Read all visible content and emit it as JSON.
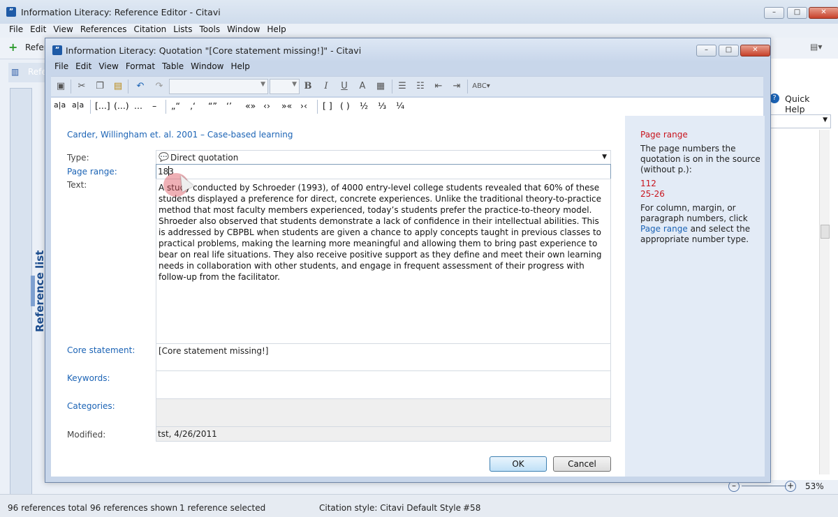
{
  "main": {
    "title": "Information Literacy: Reference Editor - Citavi",
    "menu": [
      "File",
      "Edit",
      "View",
      "References",
      "Citation",
      "Lists",
      "Tools",
      "Window",
      "Help"
    ],
    "toolbar_partial": "Refer",
    "left_tab_partial": "Refe",
    "reference_list_label": "Reference list",
    "quick_help_label": "Quick Help",
    "zoom": "53%"
  },
  "status": {
    "total": "96 references total",
    "shown": "96 references shown",
    "selected": "1 reference selected",
    "style": "Citation style: Citavi Default Style",
    "number": "#58"
  },
  "dialog": {
    "title": "Information Literacy: Quotation \"[Core statement missing!]\" - Citavi",
    "menu": [
      "File",
      "Edit",
      "View",
      "Format",
      "Table",
      "Window",
      "Help"
    ],
    "toolbar2_symbols": [
      "a|a",
      "a|a",
      "[...]",
      "(...)",
      "...",
      "–",
      "„“",
      "‚‘",
      "“”",
      "‘’",
      "«»",
      "‹›",
      "»«",
      "›‹",
      "[ ]",
      "( )",
      "½",
      "⅓",
      "¼"
    ],
    "reference": "Carder, Willingham et. al. 2001 – Case-based learning",
    "type_label": "Type:",
    "type_value": "Direct quotation",
    "page_range_label": "Page range:",
    "page_range_value": "183",
    "text_label": "Text:",
    "text_value": "A study conducted by Schroeder (1993), of 4000 entry-level college students revealed that 60% of these students displayed a preference for direct, concrete experiences. Unlike the traditional theory-to-practice method that most faculty members experienced, today’s students prefer the practice-to-theory model. Shroeder also observed that students demonstrate a lack of confidence in their intellectual abilities. This is addressed by CBPBL when students are given a chance to apply concepts taught in previous classes to practical problems, making the learning more meaningful and allowing them to bring past experience to bear on real life situations. They also receive positive support as they define and meet their own learning needs in collaboration with other students, and engage in frequent assessment of their progress with follow-up from the facilitator.",
    "core_label": "Core statement:",
    "core_value": "[Core statement missing!]",
    "keywords_label": "Keywords:",
    "categories_label": "Categories:",
    "modified_label": "Modified:",
    "modified_value": "tst, 4/26/2011",
    "ok": "OK",
    "cancel": "Cancel"
  },
  "help": {
    "title": "Page range",
    "line1": "The page numbers the",
    "line2": "quotation is on in the source",
    "line3": "(without p.):",
    "example1": "112",
    "example2": "25-26",
    "line4": "For column, margin, or",
    "line5": "paragraph numbers, click",
    "line6_link": "Page range",
    "line6_rest": " and select the",
    "line7": "appropriate number type."
  },
  "colors": {
    "accent": "#1b63b5",
    "required": "#c8141d",
    "dialog_bg": "#c8d6ea"
  }
}
